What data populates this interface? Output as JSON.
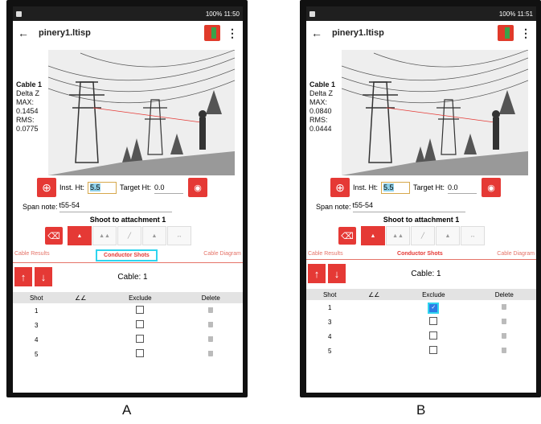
{
  "captions": [
    "A",
    "B"
  ],
  "phones": [
    {
      "status": {
        "time": "11:50",
        "battery": "100%"
      },
      "title": "pinery1.ltisp",
      "side": {
        "cable": "Cable 1",
        "delta": "Delta Z",
        "max_label": "MAX:",
        "max": "0.1454",
        "rms_label": "RMS:",
        "rms": "0.0775"
      },
      "inst_label": "Inst. Ht:",
      "inst_value": "5.5",
      "target_label": "Target Ht:",
      "target_value": "0.0",
      "span_label": "Span note:",
      "span_value": "t55-54",
      "shoot": "Shoot to attachment 1",
      "tabs": [
        "Cable Results",
        "Conductor Shots",
        "Cable Diagram"
      ],
      "cable": "Cable: 1",
      "headers": [
        "Shot",
        "∠∠",
        "Exclude",
        "Delete"
      ],
      "rows": [
        {
          "shot": "1",
          "excluded": false
        },
        {
          "shot": "3",
          "excluded": false
        },
        {
          "shot": "4",
          "excluded": false
        },
        {
          "shot": "5",
          "excluded": false
        }
      ]
    },
    {
      "status": {
        "time": "11:51",
        "battery": "100%"
      },
      "title": "pinery1.ltisp",
      "side": {
        "cable": "Cable 1",
        "delta": "Delta Z",
        "max_label": "MAX:",
        "max": "0.0840",
        "rms_label": "RMS:",
        "rms": "0.0444"
      },
      "inst_label": "Inst. Ht:",
      "inst_value": "5.5",
      "target_label": "Target Ht:",
      "target_value": "0.0",
      "span_label": "Span note:",
      "span_value": "t55-54",
      "shoot": "Shoot to attachment 1",
      "tabs": [
        "Cable Results",
        "Conductor Shots",
        "Cable Diagram"
      ],
      "cable": "Cable: 1",
      "headers": [
        "Shot",
        "∠∠",
        "Exclude",
        "Delete"
      ],
      "rows": [
        {
          "shot": "1",
          "excluded": true
        },
        {
          "shot": "3",
          "excluded": false
        },
        {
          "shot": "4",
          "excluded": false
        },
        {
          "shot": "5",
          "excluded": false
        }
      ]
    }
  ]
}
